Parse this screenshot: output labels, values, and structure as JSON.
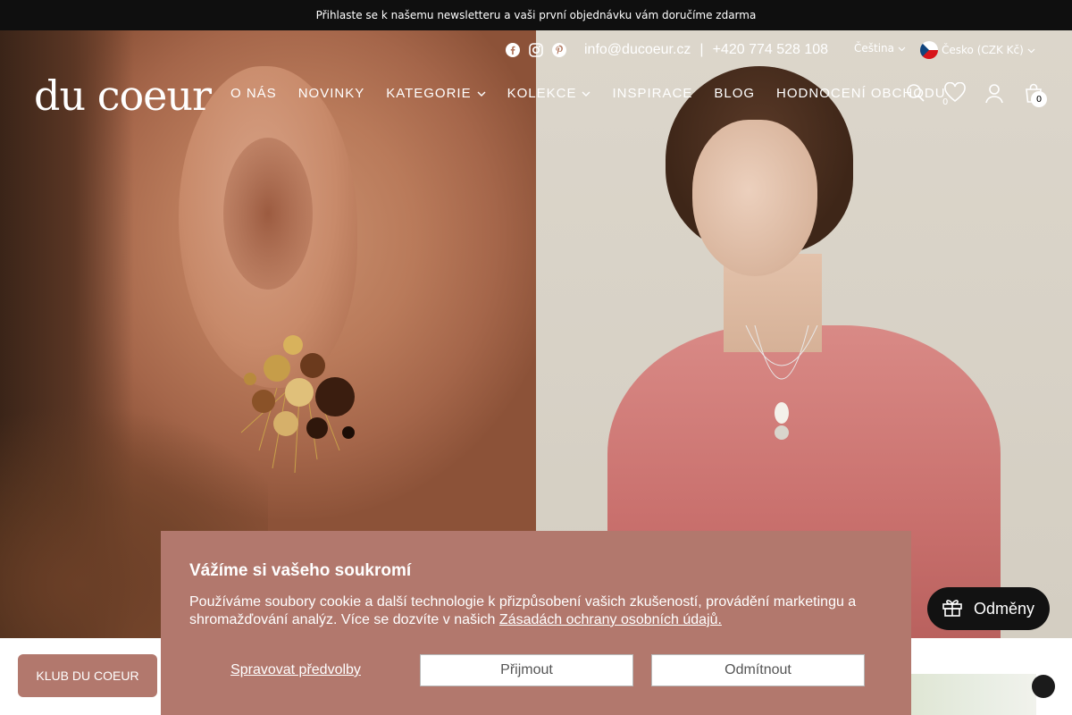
{
  "announcement": "Přihlaste se k našemu newsletteru a vaši první objednávku vám doručíme zdarma",
  "header": {
    "email": "info@ducoeur.cz",
    "separator": "|",
    "phone": "+420 774 528 108",
    "language": "Čeština",
    "country": "Česko (CZK Kč)",
    "logo": "du coeur",
    "wishlist_count": "0",
    "cart_count": "0"
  },
  "nav": {
    "items": [
      {
        "label": "O NÁS"
      },
      {
        "label": "NOVINKY"
      },
      {
        "label": "KATEGORIE"
      },
      {
        "label": "KOLEKCE"
      },
      {
        "label": "INSPIRACE"
      },
      {
        "label": "BLOG"
      },
      {
        "label": "HODNOCENÍ OBCHODU"
      }
    ]
  },
  "cookie": {
    "title": "Vážíme si vašeho soukromí",
    "text": "Používáme soubory cookie a další technologie k přizpůsobení vašich zkušeností, provádění marketingu a shromažďování analýz. Více se dozvíte v našich",
    "link": "Zásadách ochrany osobních údajů.",
    "manage": "Spravovat předvolby",
    "accept": "Přijmout",
    "reject": "Odmítnout"
  },
  "widgets": {
    "club": "KLUB DU COEUR",
    "rewards": "Odměny"
  },
  "colors": {
    "accent": "#b2786d",
    "announcement_bg": "#0f0f0f",
    "rewards_bg": "#121212"
  }
}
